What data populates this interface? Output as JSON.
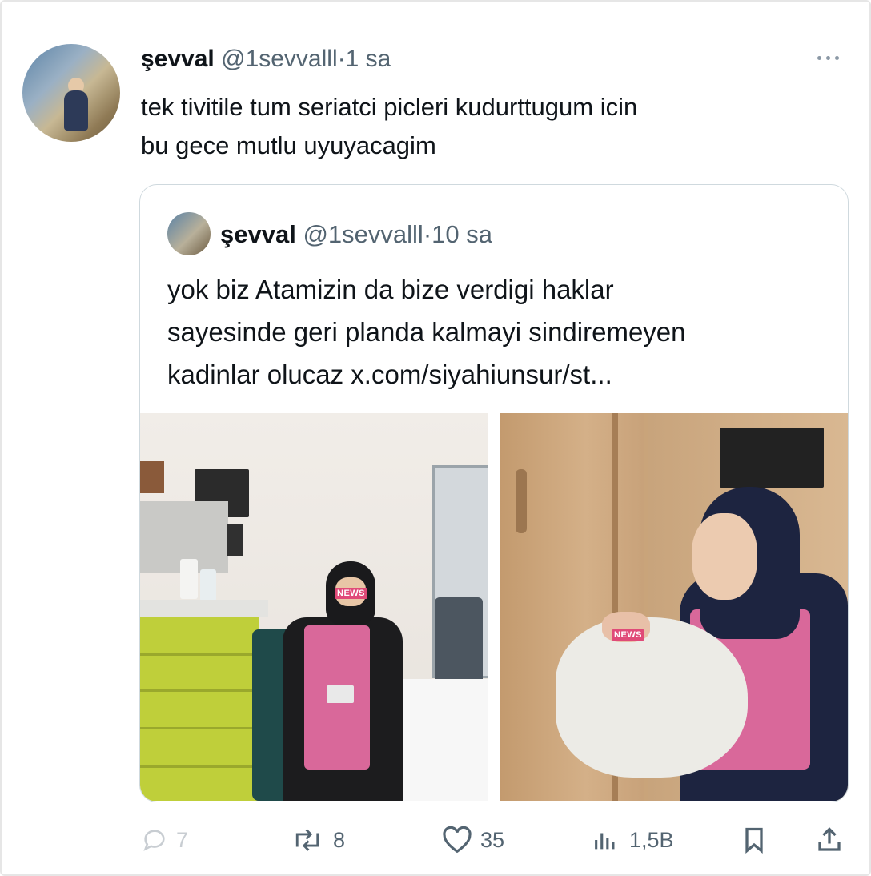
{
  "tweet": {
    "author_name": "şevval",
    "author_handle": "@1sevvalll",
    "separator": "·",
    "time": "1 sa",
    "text_line1": "tek tivitile tum seriatci picleri kudurttugum icin",
    "text_line2": "bu gece mutlu uyuyacagim"
  },
  "quote": {
    "author_name": "şevval",
    "author_handle": "@1sevvalll",
    "separator": "·",
    "time": "10 sa",
    "text_line1": "yok biz Atamizin da bize verdigi haklar",
    "text_line2": "sayesinde geri planda kalmayi sindiremeyen",
    "text_line3": "kadinlar olucaz x.com/siyahiunsur/st...",
    "photo_tag": "NEWS"
  },
  "actions": {
    "replies": "7",
    "reposts": "8",
    "likes": "35",
    "views": "1,5B"
  },
  "colors": {
    "text": "#0f1419",
    "secondary": "#536471",
    "border": "#cfd9de",
    "scrub_pink": "#d9689a",
    "hijab_navy": "#1d2440"
  },
  "icons": [
    "more-icon",
    "reply-icon",
    "repost-icon",
    "like-icon",
    "views-icon",
    "bookmark-icon",
    "share-icon"
  ]
}
